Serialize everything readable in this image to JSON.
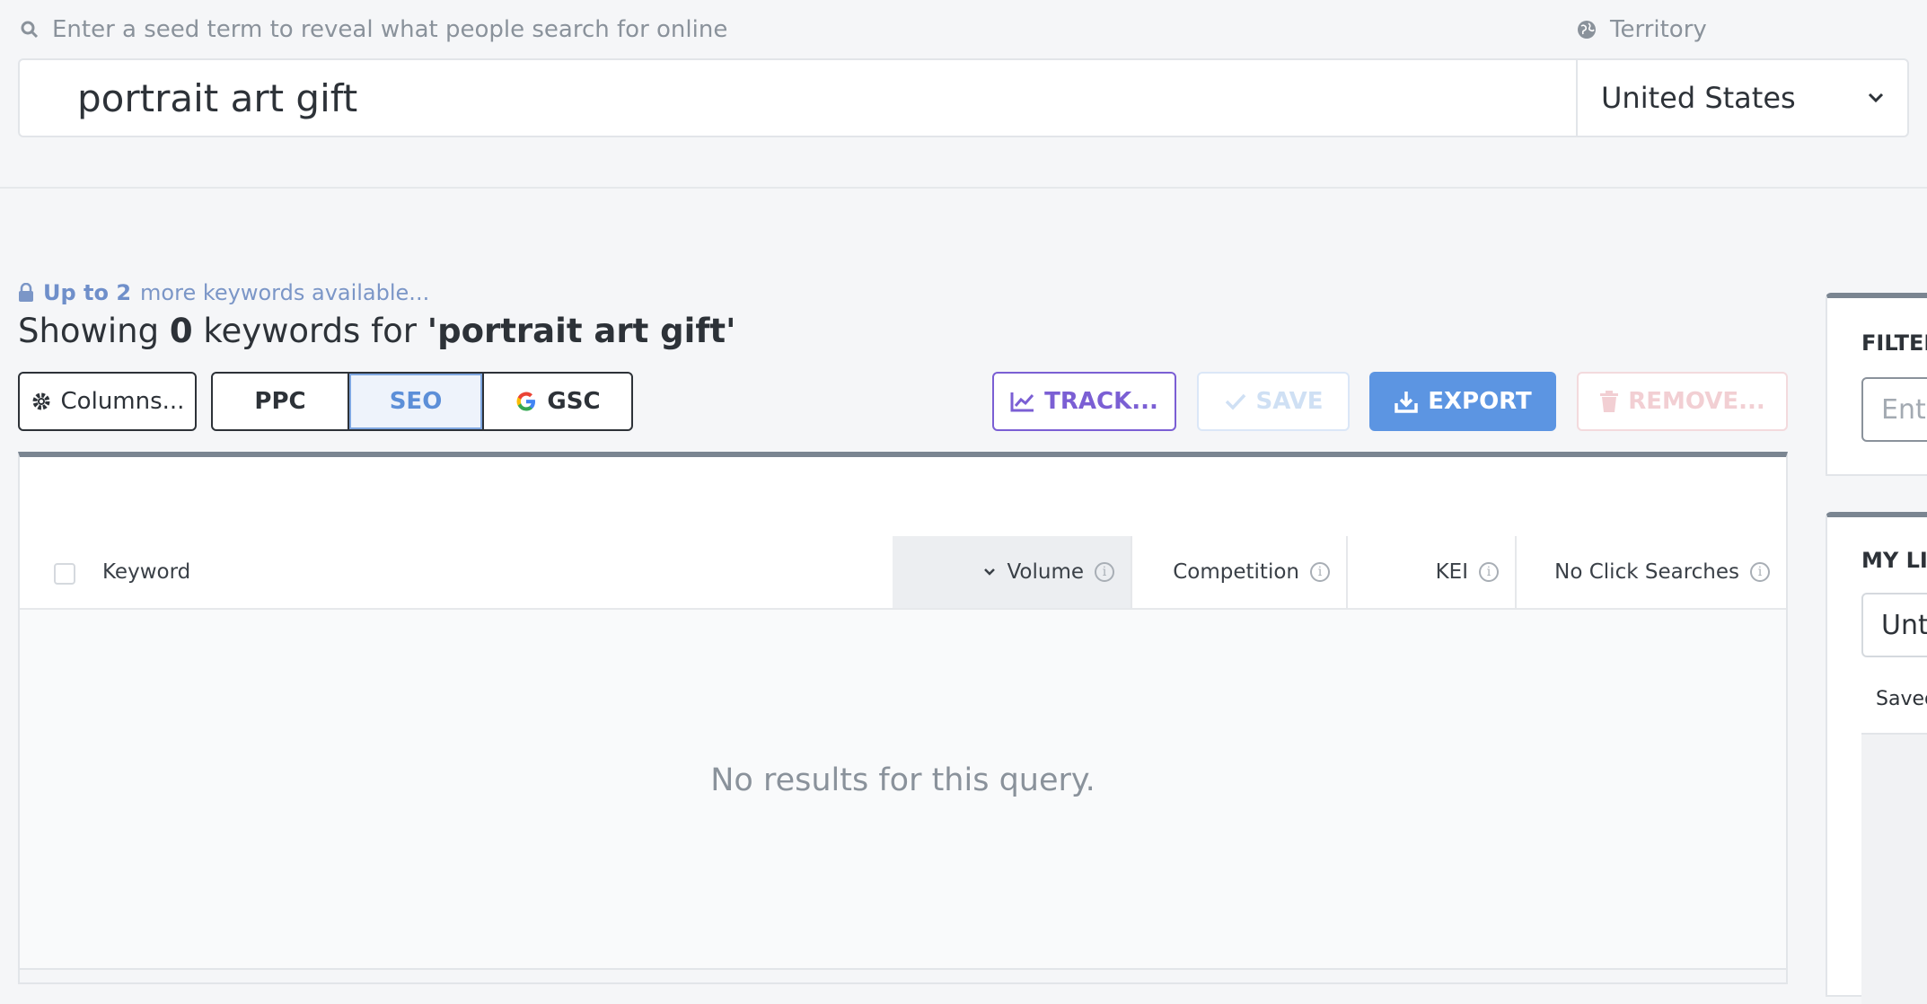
{
  "search": {
    "seed_label": "Enter a seed term to reveal what people search for online",
    "query": "portrait art gift",
    "territory_label": "Territory",
    "territory_value": "United States"
  },
  "info": {
    "more_prefix": "Up to 2",
    "more_suffix": "more keywords available...",
    "showing_prefix": "Showing",
    "showing_count": "0",
    "showing_middle": "keywords for",
    "showing_term": "'portrait art gift'"
  },
  "toolbar": {
    "columns_label": "Columns...",
    "ppc_label": "PPC",
    "seo_label": "SEO",
    "gsc_label": "GSC",
    "track_label": "TRACK...",
    "save_label": "SAVE",
    "export_label": "EXPORT",
    "remove_label": "REMOVE..."
  },
  "table": {
    "columns": [
      "Keyword",
      "Volume",
      "Competition",
      "KEI",
      "No Click Searches"
    ],
    "empty_message": "No results for this query."
  },
  "side": {
    "filters_title": "FILTERS",
    "filter_placeholder": "Enter",
    "lists_title": "MY LISTS",
    "list_value": "Untitled",
    "saved_label": "Saved"
  },
  "colors": {
    "accent_blue": "#5c95e2",
    "track_purple": "#7b5fd4",
    "remove_pink": "#f2cfd3"
  }
}
